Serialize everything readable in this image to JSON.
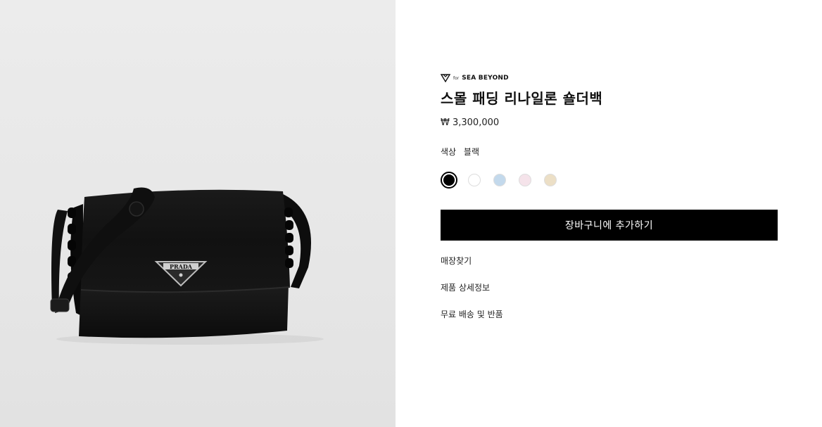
{
  "product": {
    "brand_for": "for",
    "brand_name": "SEA BEYOND",
    "title": "스몰 패딩 리나일론 숄더백",
    "price": "₩ 3,300,000",
    "image_logo_text": "PRADA"
  },
  "color": {
    "label": "색상",
    "selected_value": "블랙",
    "swatches": [
      {
        "name": "black",
        "hex": "#000000"
      },
      {
        "name": "white",
        "hex": "#ffffff"
      },
      {
        "name": "light-blue",
        "hex": "#c3d9ec"
      },
      {
        "name": "pink",
        "hex": "#f5e3ea"
      },
      {
        "name": "beige",
        "hex": "#ecdfc6"
      }
    ]
  },
  "actions": {
    "add_to_cart": "장바구니에 추가하기"
  },
  "links": {
    "store_finder": "매장찾기",
    "product_details": "제품 상세정보",
    "free_shipping": "무료 배송 및 반품"
  }
}
